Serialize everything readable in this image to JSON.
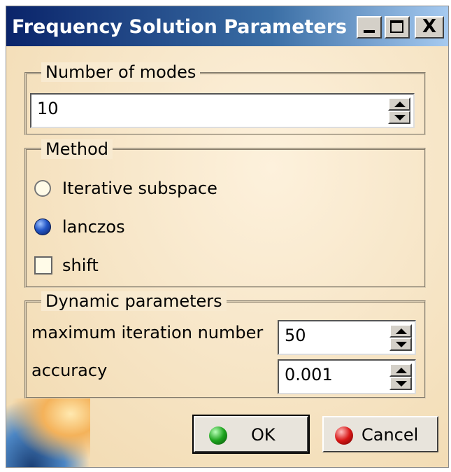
{
  "window": {
    "title": "Frequency Solution Parameters",
    "minimize_icon": "minimize-icon",
    "maximize_icon": "maximize-icon",
    "close_glyph": "X"
  },
  "modes": {
    "legend": "Number of modes",
    "value": "10"
  },
  "method": {
    "legend": "Method",
    "options": [
      {
        "label": "Iterative subspace",
        "selected": false
      },
      {
        "label": "lanczos",
        "selected": true
      }
    ],
    "shift": {
      "label": "shift",
      "checked": false
    }
  },
  "dynamic": {
    "legend": "Dynamic parameters",
    "max_iter_label": "maximum iteration number",
    "max_iter_value": "50",
    "accuracy_label": "accuracy",
    "accuracy_value": "0.001"
  },
  "buttons": {
    "ok_label": "OK",
    "cancel_label": "Cancel"
  },
  "colors": {
    "title_bar_start": "#0a246a",
    "dialog_background": "#f7e6c8",
    "ok_icon": "#1da31d",
    "cancel_icon": "#d81616"
  }
}
